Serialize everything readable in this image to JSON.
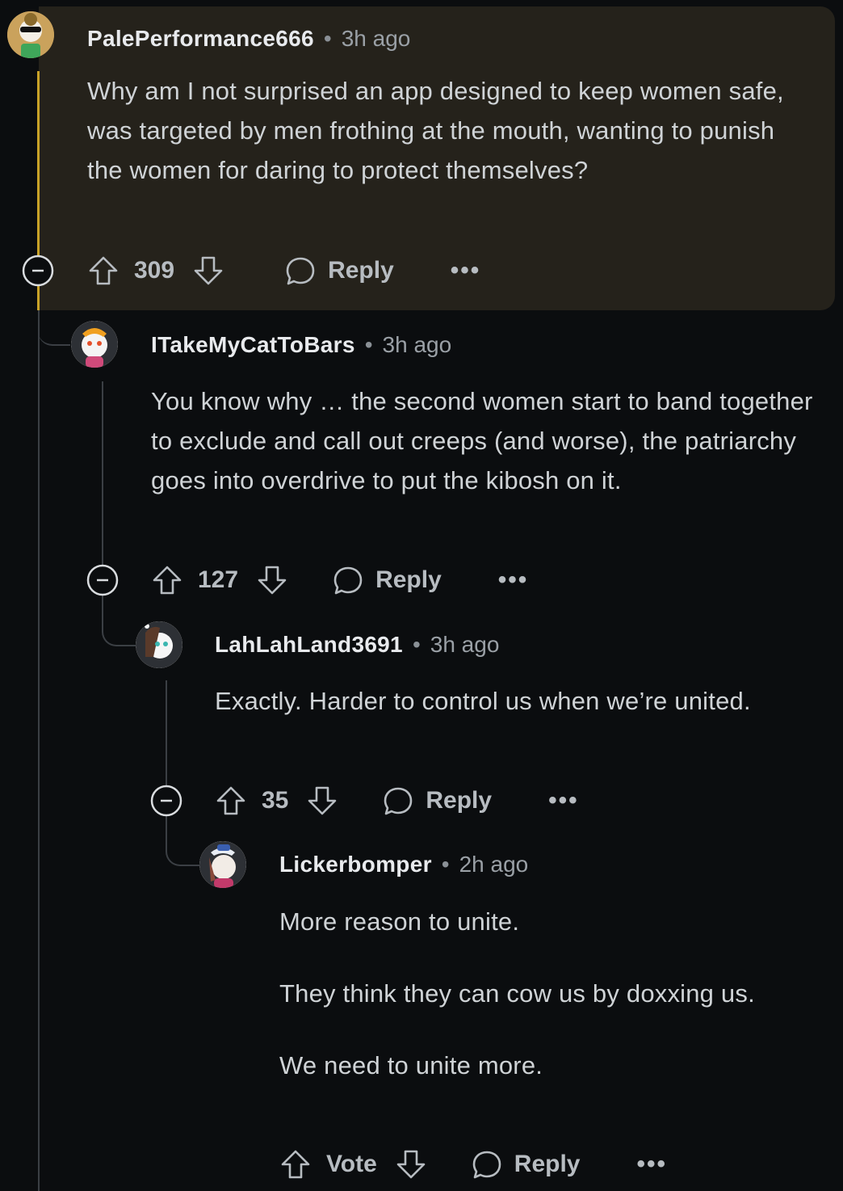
{
  "comments": [
    {
      "username": "PalePerformance666",
      "time": "3h ago",
      "paragraphs": [
        "Why am I not surprised an app designed to keep women safe, was targeted by men frothing at the mouth, wanting to punish the women for daring to protect themselves?"
      ],
      "score": "309",
      "reply_label": "Reply",
      "more_label": "•••",
      "avatar_icon": "avatar-sunglasses-icon"
    },
    {
      "username": "ITakeMyCatToBars",
      "time": "3h ago",
      "paragraphs": [
        "You know why … the second women start to band together to exclude and call out creeps (and worse), the patriarchy goes into overdrive to put the kibosh on it."
      ],
      "score": "127",
      "reply_label": "Reply",
      "more_label": "•••",
      "avatar_icon": "avatar-snoo-icon"
    },
    {
      "username": "LahLahLand3691",
      "time": "3h ago",
      "paragraphs": [
        "Exactly. Harder to control us when we’re united."
      ],
      "score": "35",
      "reply_label": "Reply",
      "more_label": "•••",
      "avatar_icon": "avatar-snoo-icon"
    },
    {
      "username": "Lickerbomper",
      "time": "2h ago",
      "paragraphs": [
        "More reason to unite.",
        "They think they can cow us by doxxing us.",
        "We need to unite more."
      ],
      "score": "Vote",
      "reply_label": "Reply",
      "more_label": "•••",
      "avatar_icon": "avatar-snoo-icon"
    }
  ],
  "colors": {
    "background": "#0b0d0f",
    "highlight": "#25221b",
    "thread_highlight": "#c9a227",
    "thread": "#3b3f44"
  }
}
